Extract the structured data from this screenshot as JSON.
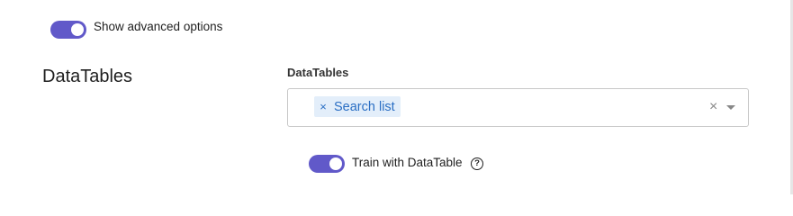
{
  "advanced_options": {
    "label": "Show advanced options",
    "enabled": true
  },
  "datatables_section": {
    "title": "DataTables",
    "field_label": "DataTables",
    "selected_chips": [
      {
        "label": "Search list",
        "remove_icon": "×"
      }
    ],
    "clear_icon": "×",
    "train_with_datatable": {
      "label": "Train with DataTable",
      "enabled": true,
      "help_icon": "?"
    }
  },
  "colors": {
    "toggle_on": "#6159c9",
    "chip_background": "#e3eefa",
    "chip_text": "#2b6fc4"
  }
}
